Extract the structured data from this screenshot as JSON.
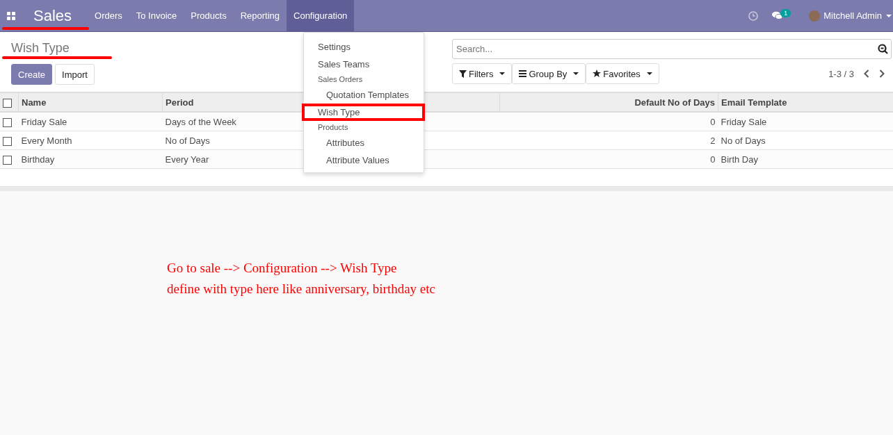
{
  "navbar": {
    "brand": "Sales",
    "brand_underlined": true,
    "menu": [
      {
        "label": "Orders",
        "selected": false
      },
      {
        "label": "To Invoice",
        "selected": false
      },
      {
        "label": "Products",
        "selected": false
      },
      {
        "label": "Reporting",
        "selected": false
      },
      {
        "label": "Configuration",
        "selected": true
      }
    ],
    "message_count": "1",
    "user": "Mitchell Admin"
  },
  "dropdown": [
    {
      "label": "Settings",
      "kind": "item",
      "highlighted": false
    },
    {
      "label": "Sales Teams",
      "kind": "item",
      "highlighted": false
    },
    {
      "label": "Sales Orders",
      "kind": "header"
    },
    {
      "label": "Quotation Templates",
      "kind": "subitem",
      "highlighted": false
    },
    {
      "label": "Wish Type",
      "kind": "item",
      "highlighted": true
    },
    {
      "label": "Products",
      "kind": "header"
    },
    {
      "label": "Attributes",
      "kind": "subitem",
      "highlighted": false
    },
    {
      "label": "Attribute Values",
      "kind": "subitem",
      "highlighted": false
    }
  ],
  "page_title": "Wish Type",
  "title_underlined": true,
  "buttons": [
    "Create",
    "Import"
  ],
  "search": {
    "placeholder": "Search..."
  },
  "search_options": [
    "Filters",
    "Group By",
    "Favorites"
  ],
  "pager": "1-3 / 3",
  "table": {
    "select_all_checked": false,
    "columns": [
      "Name",
      "Period",
      "Default No of Days",
      "Email Template"
    ],
    "rows": [
      {
        "checked": false,
        "cells": [
          "Friday Sale",
          "Days of the Week",
          "0",
          "Friday Sale"
        ]
      },
      {
        "checked": false,
        "cells": [
          "Every Month",
          "No of Days",
          "2",
          "No of Days"
        ]
      },
      {
        "checked": false,
        "cells": [
          "Birthday",
          "Every Year",
          "0",
          "Birth Day"
        ]
      }
    ]
  },
  "annotation": [
    "Go to sale --> Configuration --> Wish Type",
    "define with type here like anniversary, birthday etc"
  ]
}
